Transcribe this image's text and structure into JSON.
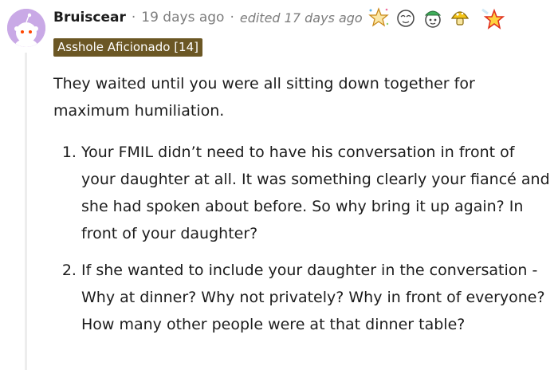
{
  "comment": {
    "username": "Bruiscear",
    "separator": "·",
    "timestamp": "19 days ago",
    "edited": "edited 17 days ago",
    "flair": "Asshole Aficionado [14]",
    "avatar_icon": "snoo-avatar-icon",
    "award_icons": [
      "sparkle-star-award-icon",
      "face-award-icon",
      "hat-face-award-icon",
      "gold-mushroom-award-icon",
      "glowing-star-award-icon"
    ],
    "paragraph": "They waited until you were all sitting down together for maximum humiliation.",
    "list_items": [
      "Your FMIL didn’t need to have his conversation in front of your daughter at all. It was something clearly your fiancé and she had spoken about before. So why bring it up again? In front of your daughter?",
      "If she wanted to include your daughter in the conversation - Why at dinner? Why not privately? Why in front of everyone? How many other people were at that dinner table?"
    ]
  },
  "colors": {
    "avatar_bg": "#c9a9e6",
    "flair_bg": "#6b5724",
    "meta_text": "#7c7c7c",
    "thread_line": "#ededed"
  }
}
